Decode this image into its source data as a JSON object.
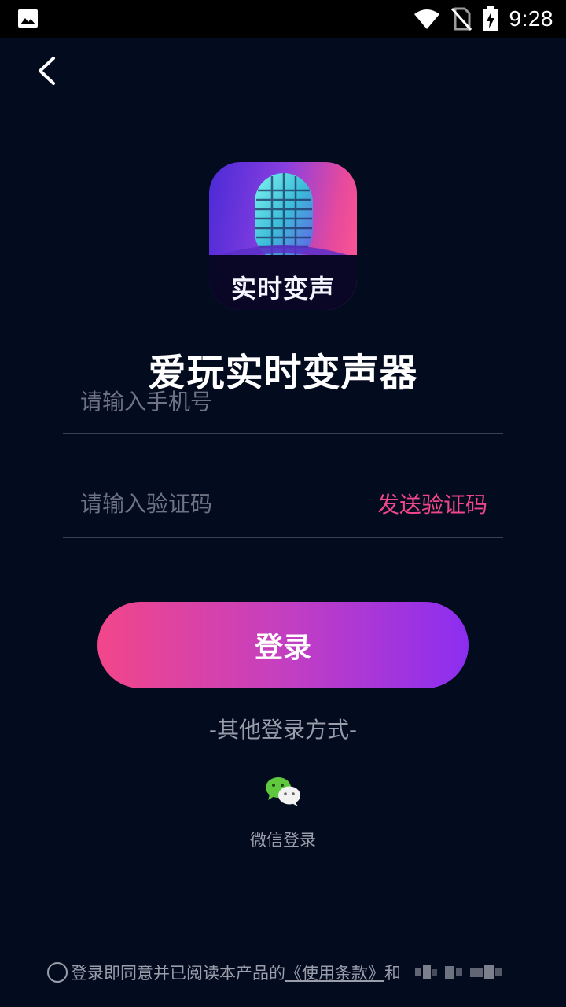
{
  "status_bar": {
    "time": "9:28"
  },
  "app": {
    "logo_text": "实时变声",
    "title": "爱玩实时变声器"
  },
  "form": {
    "phone_placeholder": "请输入手机号",
    "code_placeholder": "请输入验证码",
    "send_code_label": "发送验证码"
  },
  "login": {
    "button_label": "登录",
    "other_methods_label": "-其他登录方式-",
    "wechat_label": "微信登录"
  },
  "agreement": {
    "text": "登录即同意并已阅读本产品的",
    "terms_link": "《使用条款》",
    "and": "和"
  },
  "colors": {
    "background": "#030b1e",
    "accent_pink": "#f0468a",
    "accent_purple": "#8c2ef0"
  }
}
